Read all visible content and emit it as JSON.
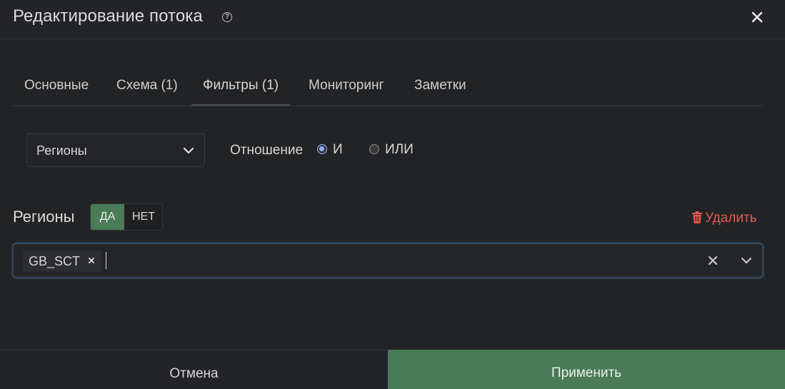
{
  "dialog": {
    "title": "Редактирование потока",
    "icons": {
      "help": "help-icon",
      "close": "close-icon"
    }
  },
  "tabs": [
    {
      "label": "Основные",
      "active": false
    },
    {
      "label": "Схема (1)",
      "active": false
    },
    {
      "label": "Фильтры (1)",
      "active": true
    },
    {
      "label": "Мониторинг",
      "active": false
    },
    {
      "label": "Заметки",
      "active": false
    }
  ],
  "filter": {
    "field_select": {
      "value": "Регионы"
    },
    "relation": {
      "label": "Отношение",
      "options": [
        {
          "label": "И",
          "selected": true
        },
        {
          "label": "ИЛИ",
          "selected": false
        }
      ]
    }
  },
  "condition": {
    "title": "Регионы",
    "toggle": {
      "yes": "ДА",
      "no": "НЕТ",
      "selected": "yes"
    },
    "delete_label": "Удалить",
    "values": [
      "GB_SCT"
    ],
    "input_value": ""
  },
  "footer": {
    "cancel_label": "Отмена",
    "apply_label": "Применить"
  },
  "colors": {
    "background": "#222325",
    "accent_green": "#4a7b57",
    "danger": "#e05a4e",
    "focus_border": "#334a5e",
    "radio_selected": "#8fb0e8"
  }
}
